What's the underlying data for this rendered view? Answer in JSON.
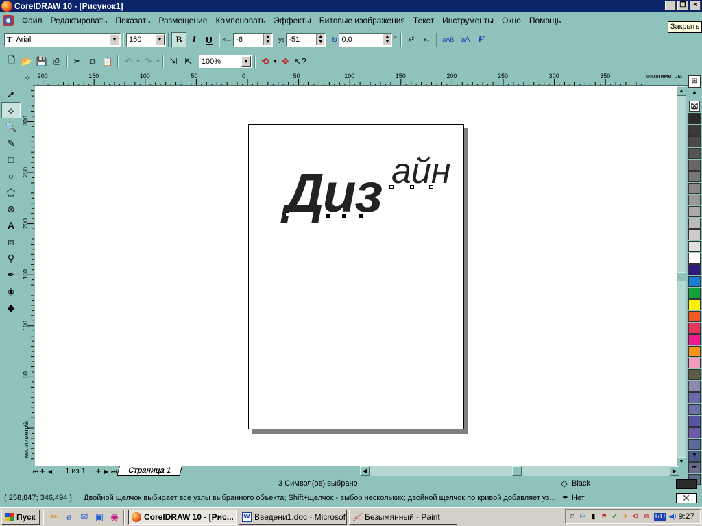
{
  "window": {
    "title": "CorelDRAW 10 - [Рисунок1]"
  },
  "menu": [
    "Файл",
    "Редактировать",
    "Показать",
    "Размещение",
    "Компоновать",
    "Эффекты",
    "Битовые изображения",
    "Текст",
    "Инструменты",
    "Окно",
    "Помощь"
  ],
  "tooltip": "Закрыть",
  "property_bar": {
    "font_name": "Arial",
    "font_size": "150",
    "bold": "B",
    "italic": "I",
    "underline": "U",
    "h_shift": "-6",
    "v_shift": "-51",
    "rotation": "0,0",
    "degree": "°",
    "superscript": "x²",
    "subscript": "x₂",
    "case_small": "aАВ",
    "case_caps": "аA",
    "format": "F"
  },
  "standard_bar": {
    "zoom": "100%"
  },
  "rulers": {
    "unit": "миллиметры",
    "h_ticks": [
      "200",
      "150",
      "100",
      "50",
      "0",
      "50",
      "100",
      "150",
      "200",
      "250",
      "300",
      "350"
    ],
    "v_ticks": [
      "300",
      "250",
      "200",
      "150",
      "100",
      "50",
      "0"
    ]
  },
  "canvas": {
    "main_text": "Диз",
    "superscript_text": "айн"
  },
  "page_nav": {
    "counter": "1 из 1",
    "tab": "Страница 1"
  },
  "status": {
    "selection": "3 Символ(ов) выбрано",
    "fill_name": "Black",
    "outline_name": "Нет",
    "coords": "( 258,847; 346,494 )",
    "hint": "Двойной щелчок выбирает все узлы выбранного объекта; Shift+щелчок - выбор нескольких; двойной щелчок по кривой добавляет уз..."
  },
  "palette": [
    "#2a2a2a",
    "#3a3a3a",
    "#4a4a4a",
    "#555555",
    "#666666",
    "#777777",
    "#888888",
    "#999999",
    "#aaaaaa",
    "#bbbbbb",
    "#cccccc",
    "#e0e0e0",
    "#ffffff",
    "#2b1c7a",
    "#1a7fd0",
    "#13a13a",
    "#fff200",
    "#f15a22",
    "#e8355d",
    "#ec1c8c",
    "#f7941d",
    "#f49ac1",
    "#605a48",
    "#8a8ab0",
    "#6a6aa8",
    "#7070a8",
    "#5555a0",
    "#6a5aa8",
    "#5a6a9a",
    "#4a5a8a",
    "#6a6a8a",
    "#5a708a"
  ],
  "taskbar": {
    "start": "Пуск",
    "tasks": [
      "CorelDRAW 10 - [Рис...",
      "Введени1.doc - Microsoft ...",
      "Безымянный - Paint"
    ],
    "tray_lang": "RU",
    "clock": "9:27"
  }
}
